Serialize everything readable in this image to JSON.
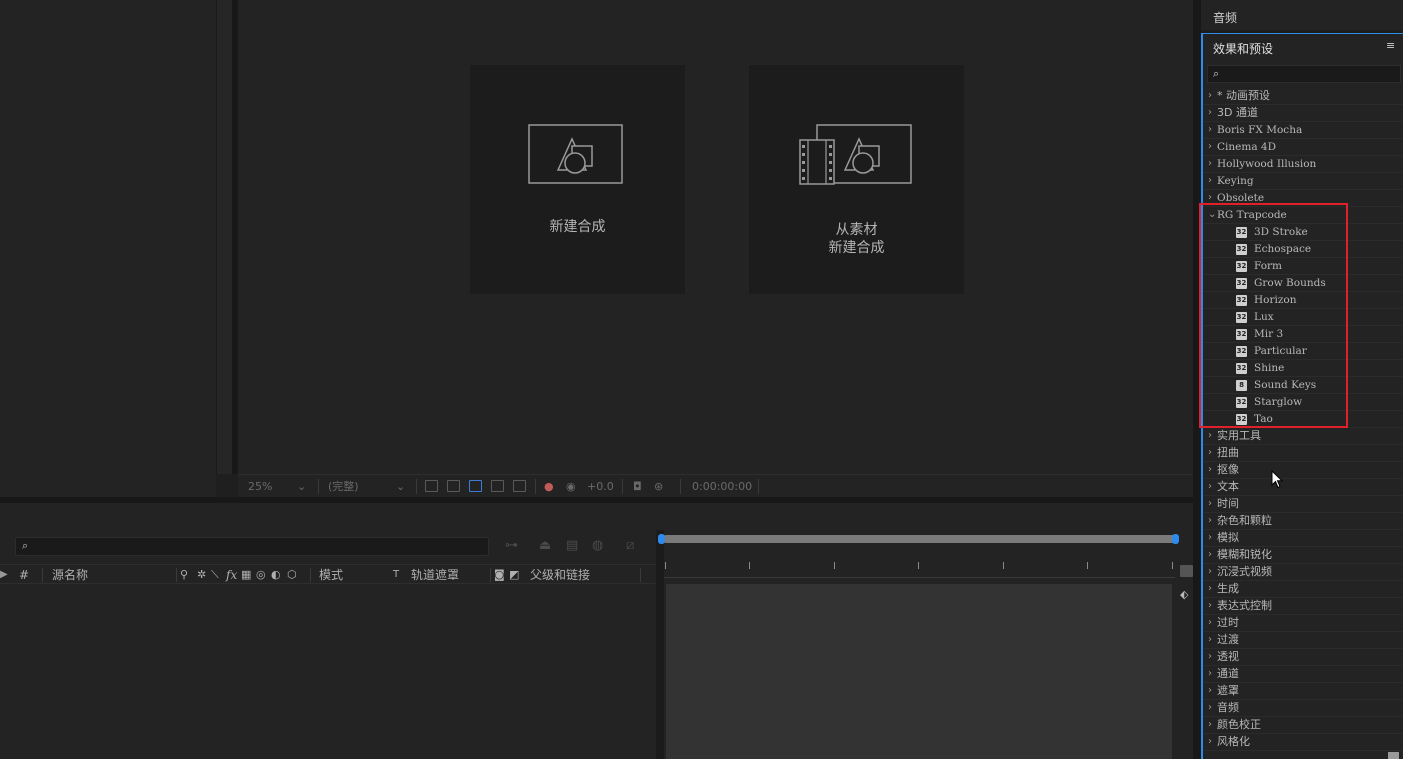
{
  "viewer": {
    "new_comp_label": "新建合成",
    "comp_from_footage_line1": "从素材",
    "comp_from_footage_line2": "新建合成",
    "toolbar": {
      "zoom": "25%",
      "resolution": "(完整)",
      "exposure": "+0.0",
      "timecode": "0:00:00:00"
    }
  },
  "timeline": {
    "columns": {
      "number": "#",
      "source_name": "源名称",
      "mode": "模式",
      "t": "T",
      "track_matte": "轨道遮罩",
      "parent_link": "父级和链接"
    }
  },
  "audio_panel": {
    "title": "音频"
  },
  "effects_panel": {
    "title": "效果和预设",
    "categories_top": [
      {
        "label": "* 动画预设",
        "lang": "cn"
      },
      {
        "label": "3D 通道",
        "lang": "cn"
      },
      {
        "label": "Boris FX Mocha",
        "lang": "en"
      },
      {
        "label": "Cinema 4D",
        "lang": "en"
      },
      {
        "label": "Hollywood Illusion",
        "lang": "en"
      },
      {
        "label": "Keying",
        "lang": "en"
      },
      {
        "label": "Obsolete",
        "lang": "en"
      }
    ],
    "expanded_category": "RG Trapcode",
    "expanded_items": [
      {
        "label": "3D Stroke",
        "badge": "32"
      },
      {
        "label": "Echospace",
        "badge": "32"
      },
      {
        "label": "Form",
        "badge": "32"
      },
      {
        "label": "Grow Bounds",
        "badge": "32"
      },
      {
        "label": "Horizon",
        "badge": "32"
      },
      {
        "label": "Lux",
        "badge": "32"
      },
      {
        "label": "Mir 3",
        "badge": "32"
      },
      {
        "label": "Particular",
        "badge": "32"
      },
      {
        "label": "Shine",
        "badge": "32"
      },
      {
        "label": "Sound Keys",
        "badge": "8"
      },
      {
        "label": "Starglow",
        "badge": "32"
      },
      {
        "label": "Tao",
        "badge": "32"
      }
    ],
    "categories_bottom": [
      "实用工具",
      "扭曲",
      "抠像",
      "文本",
      "时间",
      "杂色和颗粒",
      "模拟",
      "模糊和锐化",
      "沉浸式视频",
      "生成",
      "表达式控制",
      "过时",
      "过渡",
      "透视",
      "通道",
      "遮罩",
      "音频",
      "颜色校正",
      "风格化"
    ],
    "highlight_color": "#e0202a",
    "accent_color": "#2d8ceb"
  }
}
